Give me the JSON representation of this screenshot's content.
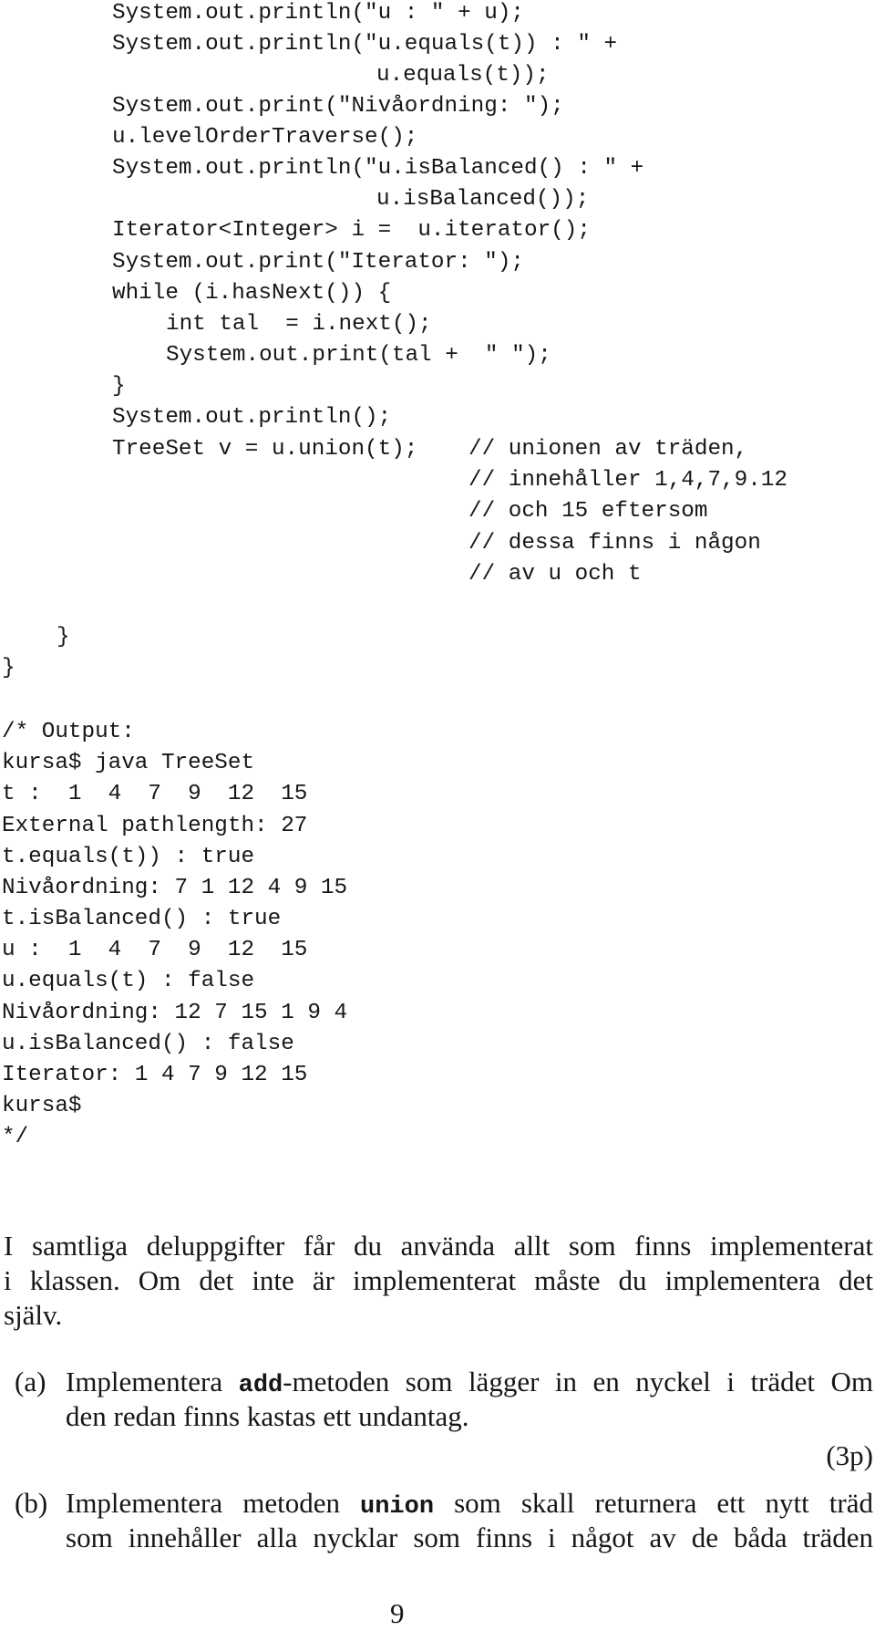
{
  "code": {
    "main_lines": [
      "System.out.println(\"u : \" + u);",
      "System.out.println(\"u.equals(t)) : \" +",
      "u.equals(t));",
      "System.out.print(\"Nivåordning: \");",
      "u.levelOrderTraverse();",
      "System.out.println(\"u.isBalanced() : \" +",
      "u.isBalanced());",
      "Iterator<Integer> i =  u.iterator();",
      "System.out.print(\"Iterator: \");",
      "while (i.hasNext()) {",
      "int tal  = i.next();",
      "System.out.print(tal +  \" \");",
      "}",
      "System.out.println();",
      "TreeSet v = u.union(t);"
    ],
    "comment_lines": [
      "// unionen av träden,",
      "// innehåller 1,4,7,9.12",
      "// och 15 eftersom",
      "// dessa finns i någon",
      "// av u och t"
    ],
    "closing_method_brace": "}",
    "closing_class_brace": "}"
  },
  "output": {
    "lines": [
      "/* Output:",
      "kursa$ java TreeSet",
      "t :  1  4  7  9  12  15",
      "External pathlength: 27",
      "t.equals(t)) : true",
      "Nivåordning: 7 1 12 4 9 15",
      "t.isBalanced() : true",
      "u :  1  4  7  9  12  15",
      "u.equals(t) : false",
      "Nivåordning: 12 7 15 1 9 4",
      "u.isBalanced() : false",
      "Iterator: 1 4 7 9 12 15",
      "kursa$",
      "*/"
    ]
  },
  "instructions": {
    "lines": [
      "I samtliga deluppgifter får du använda allt som finns implementerat",
      "i klassen. Om det inte är implementerat måste du implementera det",
      "själv."
    ]
  },
  "tasks": [
    {
      "label": "(a)",
      "line1_before": "Implementera ",
      "line1_code": "add",
      "line1_after": "-metoden som lägger in en nyckel i trädet Om",
      "line2": "den redan finns kastas ett undantag.",
      "points": "(3p)"
    },
    {
      "label": "(b)",
      "line1_before": "Implementera metoden ",
      "line1_code": "union",
      "line1_after": " som skall returnera ett nytt träd",
      "line2": "som innehåller alla nycklar som finns i något av de båda träden"
    }
  ],
  "page_number": "9"
}
